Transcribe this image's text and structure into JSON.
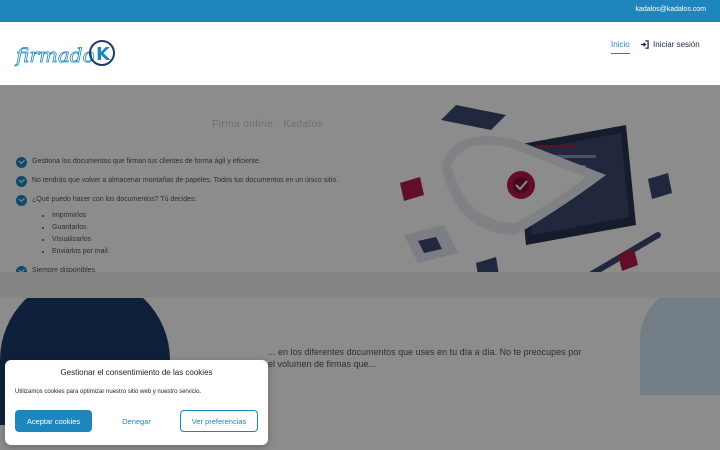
{
  "topbar": {
    "email": "kadalos@kadalos.com"
  },
  "header": {
    "logo_alt": "firmado k",
    "nav": {
      "inicio": "Inicio",
      "login": "Iniciar sesión"
    }
  },
  "hero": {
    "title": "Firma online · Kadalos",
    "features": [
      "Gestiona los documentos que firman tus clientes de forma ágil y eficiente.",
      "No tendrás que volver a almacenar montañas de papeles. Todos tus documentos en un único sitio.",
      "¿Qué puedo hacer con los documentos? Tú decides:"
    ],
    "subitems": [
      "Imprimirlos",
      "Guardarlos",
      "Visualizarlos",
      "Enviarlos por mail"
    ],
    "last_feature": "Siempre disponibles."
  },
  "body_text": "... en los diferentes documentos que uses en tu día a día. No te preocupes por el volumen de firmas que...",
  "cookie": {
    "title": "Gestionar el consentimiento de las cookies",
    "text": "Utilizamos cookies para optimizar nuestro sitio web y nuestro servicio.",
    "accept": "Aceptar cookies",
    "deny": "Denegar",
    "prefs": "Ver preferencias"
  },
  "colors": {
    "brand": "#1f86bd",
    "dark": "#1d3c6b",
    "accent": "#b31b4b"
  }
}
